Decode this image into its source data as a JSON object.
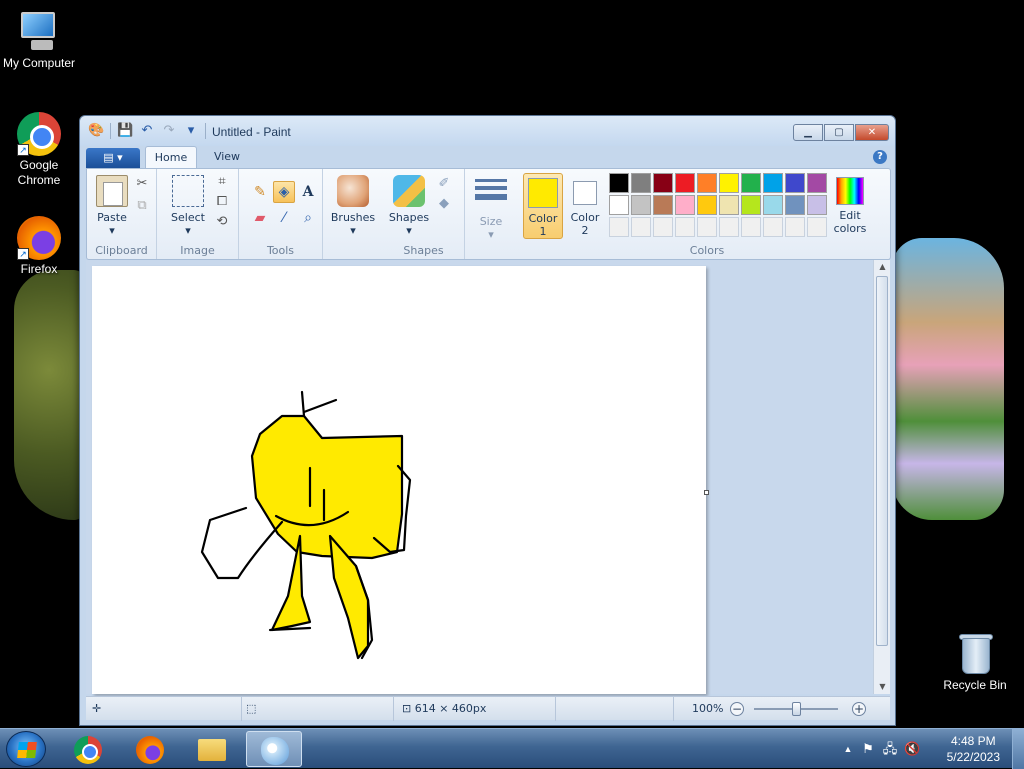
{
  "desktop": {
    "icons": [
      {
        "label": "My Computer",
        "icon": "computer-icon"
      },
      {
        "label": "Google Chrome",
        "icon": "chrome-icon"
      },
      {
        "label": "Firefox",
        "icon": "firefox-icon"
      },
      {
        "label": "Recycle Bin",
        "icon": "recycle-bin-icon"
      }
    ]
  },
  "window": {
    "title": "Untitled - Paint",
    "controls": {
      "minimize": "▁",
      "maximize": "▢",
      "close": "✕"
    },
    "qat": {
      "customize": "▾"
    }
  },
  "tabs": {
    "file": "▤ ▾",
    "home": "Home",
    "view": "View",
    "help": "?"
  },
  "ribbon": {
    "clipboard": {
      "label": "Clipboard",
      "paste": "Paste"
    },
    "image": {
      "label": "Image",
      "select": "Select"
    },
    "tools": {
      "label": "Tools"
    },
    "brushes": {
      "label": "Brushes"
    },
    "shapes": {
      "label": "Shapes",
      "group_label": "Shapes"
    },
    "size": {
      "label": "Size"
    },
    "colors": {
      "label": "Colors",
      "color1_line1": "Color",
      "color1_line2": "1",
      "color2_line1": "Color",
      "color2_line2": "2",
      "color1_value": "#ffea00",
      "color2_value": "#ffffff",
      "edit_line1": "Edit",
      "edit_line2": "colors",
      "palette": [
        "#000000",
        "#7f7f7f",
        "#880015",
        "#ed1c24",
        "#ff7f27",
        "#fff200",
        "#22b14c",
        "#00a2e8",
        "#3f48cc",
        "#a349a4",
        "#ffffff",
        "#c3c3c3",
        "#b97a57",
        "#ffaec9",
        "#ffc90e",
        "#efe4b0",
        "#b5e61d",
        "#99d9ea",
        "#7092be",
        "#c8bfe7",
        "#f0f0f0",
        "#f0f0f0",
        "#f0f0f0",
        "#f0f0f0",
        "#f0f0f0",
        "#f0f0f0",
        "#f0f0f0",
        "#f0f0f0",
        "#f0f0f0",
        "#f0f0f0"
      ]
    }
  },
  "canvas": {
    "fill_color": "#ffea00",
    "stroke_color": "#000000"
  },
  "statusbar": {
    "dimensions": "614 × 460px",
    "zoom": "100%",
    "zoom_out": "−",
    "zoom_in": "+"
  },
  "taskbar": {
    "items": [
      {
        "name": "chrome"
      },
      {
        "name": "firefox"
      },
      {
        "name": "file-explorer"
      },
      {
        "name": "paint",
        "active": true
      }
    ],
    "tray": {
      "time": "4:48 PM",
      "date": "5/22/2023",
      "arrow": "▲"
    }
  }
}
